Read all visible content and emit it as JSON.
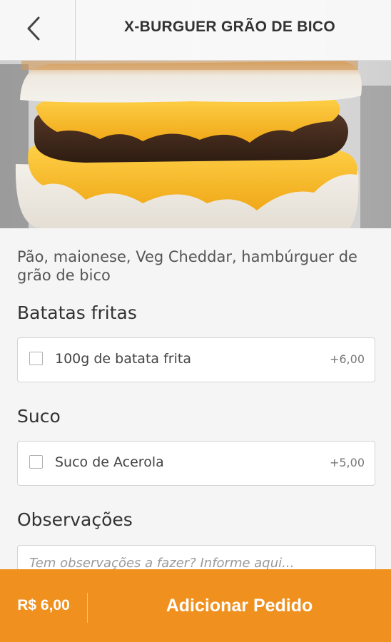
{
  "header": {
    "back_icon": "chevron-left-icon",
    "title": "X-BURGUER GRÃO DE BICO"
  },
  "product": {
    "image_alt": "burger photo",
    "description": "Pão, maionese, Veg Cheddar, hambúrguer de grão de bico"
  },
  "sections": [
    {
      "title": "Batatas fritas",
      "options": [
        {
          "label": "100g de batata frita",
          "price": "+6,00",
          "checked": false
        }
      ]
    },
    {
      "title": "Suco",
      "options": [
        {
          "label": "Suco de Acerola",
          "price": "+5,00",
          "checked": false
        }
      ]
    }
  ],
  "observations": {
    "title": "Observações",
    "placeholder": "Tem observações a fazer? Informe aqui..."
  },
  "footer": {
    "total": "R$ 6,00",
    "add_label": "Adicionar Pedido"
  },
  "colors": {
    "accent": "#f0901e",
    "background": "#f5f5f5"
  }
}
